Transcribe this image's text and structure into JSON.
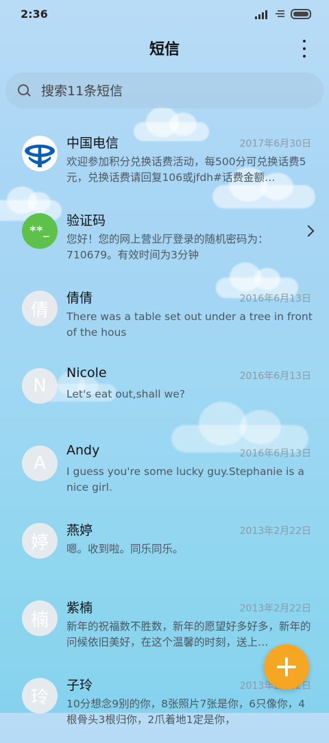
{
  "status_bar": {
    "time": "2:36"
  },
  "header": {
    "title": "短信",
    "menu_icon": "more-vertical-icon"
  },
  "search": {
    "placeholder": "搜索11条短信",
    "icon": "search-icon"
  },
  "conversations": [
    {
      "name": "中国电信",
      "date": "2017年6月30日",
      "preview": "欢迎参加积分兑换话费活动，每500分可兑换话费5元，兑换话费请回复106或jfdh#话费金额…",
      "avatar": ""
    },
    {
      "name": "验证码",
      "date": "",
      "preview": "您好！您的网上营业厅登录的随机密码为：710679。有效时间为3分钟",
      "avatar": "**_"
    },
    {
      "name": "倩倩",
      "date": "2016年6月13日",
      "preview": "There was a table set out under a tree in front of the hous",
      "avatar": "倩"
    },
    {
      "name": "Nicole",
      "date": "2016年6月13日",
      "preview": "Let's eat out,shall we?",
      "avatar": "N"
    },
    {
      "name": "Andy",
      "date": "2016年6月13日",
      "preview": "I guess you're some lucky guy.Stephanie is a nice girl.",
      "avatar": "A"
    },
    {
      "name": "燕婷",
      "date": "2013年2月22日",
      "preview": "嗯。收到啦。同乐同乐。",
      "avatar": "婷"
    },
    {
      "name": "紫楠",
      "date": "2013年2月22日",
      "preview": "新年的祝福数不胜数，新年的愿望好多好多，新年的问候依旧美好，在这个温馨的时刻，送上…",
      "avatar": "楠"
    },
    {
      "name": "子玲",
      "date": "2013年2月22日",
      "preview": "10分想念9别的你，8张照片7张是你，6只像你，4根骨头3根归你，2爪着地1定是你，",
      "avatar": "玲"
    }
  ],
  "fab": {
    "icon": "plus-icon"
  },
  "colors": {
    "accent": "#f5a623",
    "verify_avatar": "#5ec24a",
    "telecom_blue": "#0a5fb4"
  }
}
